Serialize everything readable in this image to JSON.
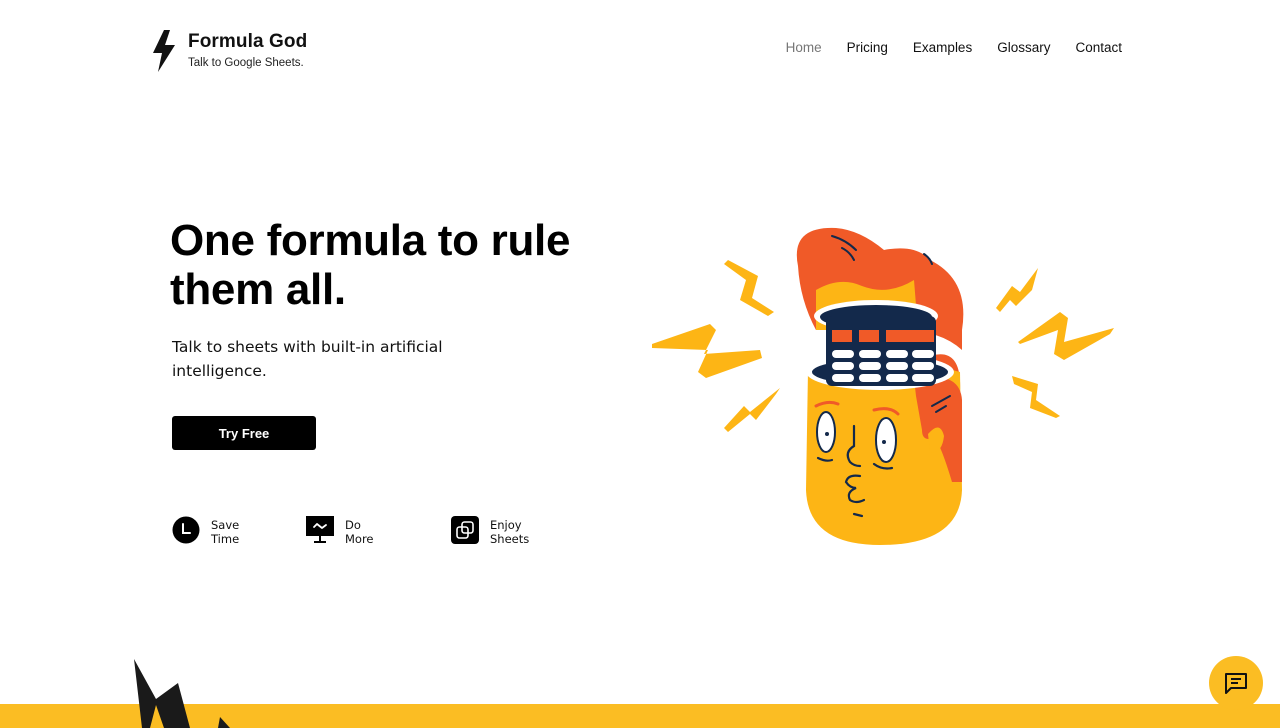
{
  "brand": {
    "name": "Formula God",
    "tagline": "Talk to Google Sheets.",
    "logo_icon": "lightning-bolt-icon"
  },
  "nav": {
    "items": [
      {
        "label": "Home",
        "active": true
      },
      {
        "label": "Pricing",
        "active": false
      },
      {
        "label": "Examples",
        "active": false
      },
      {
        "label": "Glossary",
        "active": false
      },
      {
        "label": "Contact",
        "active": false
      }
    ]
  },
  "hero": {
    "title_line1": "One formula to rule",
    "title_line2": "them all.",
    "subtitle": "Talk to sheets with built-in artificial intelligence.",
    "cta_label": "Try Free",
    "illustration": "head-with-calculator-brain"
  },
  "features": [
    {
      "icon": "clock-icon",
      "line1": "Save",
      "line2": "Time"
    },
    {
      "icon": "monitor-chart-icon",
      "line1": "Do",
      "line2": "More"
    },
    {
      "icon": "linked-squares-icon",
      "line1": "Enjoy",
      "line2": "Sheets"
    }
  ],
  "chat": {
    "icon": "chat-message-icon"
  },
  "colors": {
    "accent_yellow": "#FBBD23",
    "hair_orange": "#F05A28",
    "face_yellow": "#FDB515",
    "navy": "#13294B",
    "text_black": "#000000",
    "nav_active": "#777777"
  }
}
